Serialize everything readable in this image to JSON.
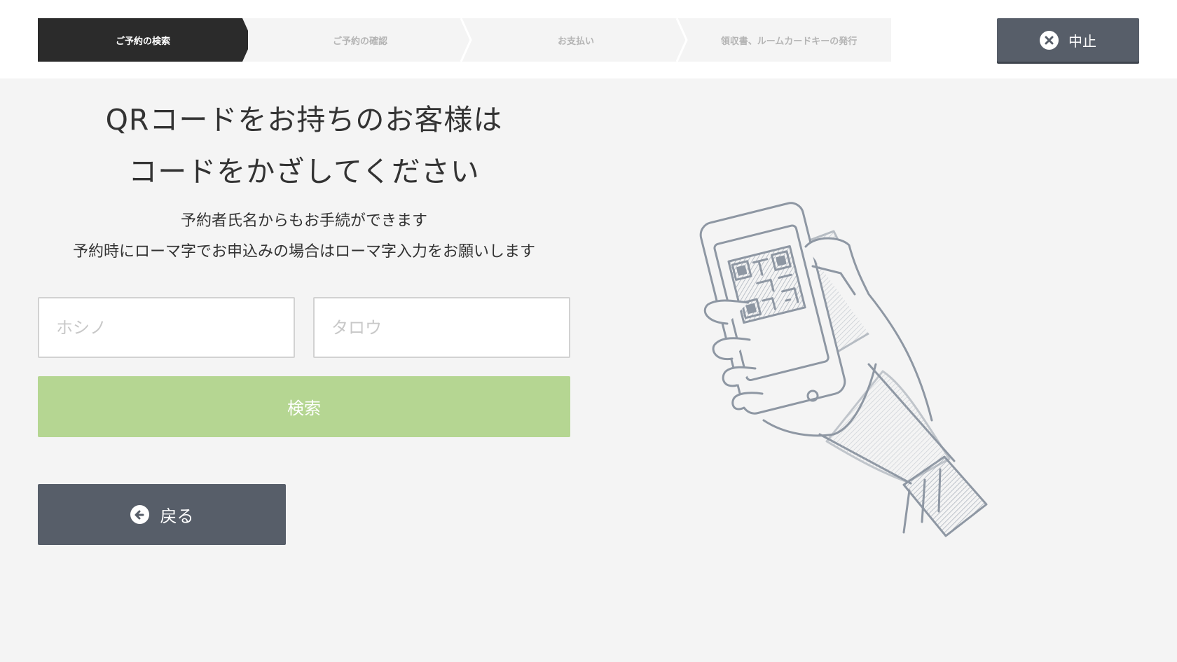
{
  "steps": [
    {
      "label": "ご予約の検索",
      "active": true
    },
    {
      "label": "ご予約の確認",
      "active": false
    },
    {
      "label": "お支払い",
      "active": false
    },
    {
      "label": "領収書、ルームカードキーの発行",
      "active": false
    }
  ],
  "cancel_button": {
    "label": "中止",
    "icon": "close-circle-icon"
  },
  "headline": {
    "line1": "QRコードをお持ちのお客様は",
    "line2": "コードをかざしてください"
  },
  "subtext": {
    "line1": "予約者氏名からもお手続ができます",
    "line2": "予約時にローマ字でお申込みの場合はローマ字入力をお願いします"
  },
  "form": {
    "last_name": {
      "value": "",
      "placeholder": "ホシノ"
    },
    "first_name": {
      "value": "",
      "placeholder": "タロウ"
    },
    "search_label": "検索"
  },
  "back_button": {
    "label": "戻る",
    "icon": "arrow-left-circle-icon"
  },
  "colors": {
    "active_step": "#2b2b2b",
    "inactive_step": "#f4f4f4",
    "button_dark": "#575e69",
    "search_green": "#b5d692",
    "background": "#f4f4f4"
  },
  "illustration": {
    "icon": "hand-holding-phone-qr-icon"
  }
}
